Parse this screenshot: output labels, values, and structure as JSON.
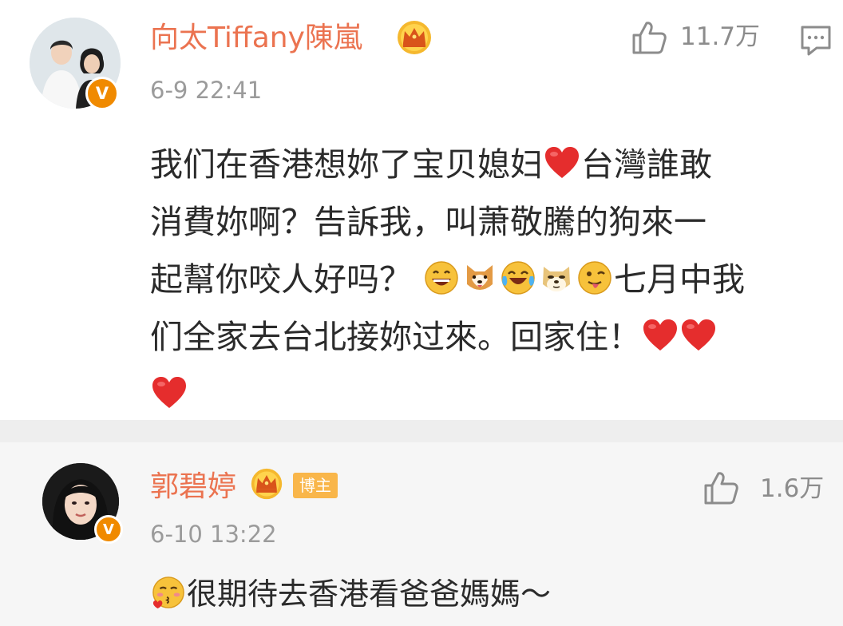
{
  "comments": [
    {
      "username": "向太Tiffany陳嵐",
      "timestamp": "6-9 22:41",
      "likes": "11.7万",
      "verified_badge": "V",
      "text_lines": [
        "我们在香港想妳了宝贝媳妇",
        "台灣誰敢",
        "消費妳啊？告訴我，叫萧敬騰的狗來一",
        "起幫你咬人好吗？",
        "七月中我",
        "们全家去台北接妳过來。回家住！"
      ],
      "icons": [
        "crown-icon",
        "thumbs-up-icon",
        "reply-icon",
        "heart-icon",
        "grin-emoji-icon",
        "shiba-dog-icon",
        "laugh-cry-emoji-icon",
        "doge-icon",
        "tongue-wink-emoji-icon"
      ]
    },
    {
      "username": "郭碧婷",
      "role_badge": "博主",
      "timestamp": "6-10 13:22",
      "likes": "1.6万",
      "verified_badge": "V",
      "text": "很期待去香港看爸爸媽媽～",
      "icons": [
        "crown-icon",
        "thumbs-up-icon",
        "blush-kiss-emoji-icon"
      ]
    }
  ],
  "colors": {
    "username": "#eb7350",
    "timestamp": "#9b9b9b",
    "body_text": "#2b2b2b",
    "verified_badge": "#f08a00",
    "role_badge": "#f9b64a",
    "heart": "#e52d2d",
    "divider": "#eeeeee",
    "reply_background": "#f6f6f6"
  }
}
